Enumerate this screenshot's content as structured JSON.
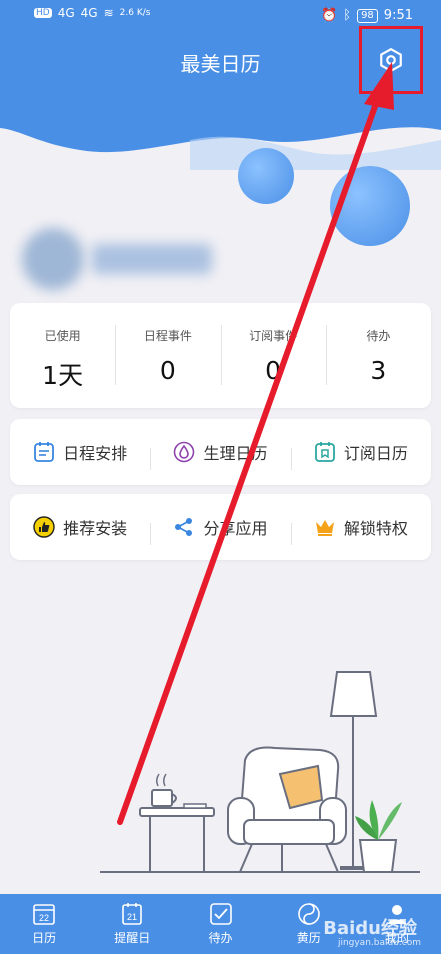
{
  "status_bar": {
    "net_speed": "2.6 K/s",
    "battery": "98",
    "time": "9:51",
    "signal_a": "4G",
    "signal_b": "4G"
  },
  "header": {
    "title": "最美日历"
  },
  "stats": [
    {
      "label": "已使用",
      "value": "1天"
    },
    {
      "label": "日程事件",
      "value": "0"
    },
    {
      "label": "订阅事件",
      "value": "0"
    },
    {
      "label": "待办",
      "value": "3"
    }
  ],
  "menu_row_1": [
    {
      "label": "日程安排",
      "icon": "schedule-icon"
    },
    {
      "label": "生理日历",
      "icon": "drop-icon"
    },
    {
      "label": "订阅日历",
      "icon": "subscribe-icon"
    }
  ],
  "menu_row_2": [
    {
      "label": "推荐安装",
      "icon": "thumbs-up-icon"
    },
    {
      "label": "分享应用",
      "icon": "share-icon"
    },
    {
      "label": "解锁特权",
      "icon": "crown-icon"
    }
  ],
  "tabbar": [
    {
      "label": "日历",
      "icon_text": "22"
    },
    {
      "label": "提醒日",
      "icon_text": "21"
    },
    {
      "label": "待办",
      "icon_text": ""
    },
    {
      "label": "黄历",
      "icon_text": ""
    },
    {
      "label": "我的",
      "icon_text": ""
    }
  ],
  "watermark": {
    "brand": "Baidu经验",
    "url": "jingyan.baidu.com"
  },
  "colors": {
    "primary": "#4a8fe6",
    "highlight": "#e61b2b",
    "background": "#f1f0f5"
  }
}
